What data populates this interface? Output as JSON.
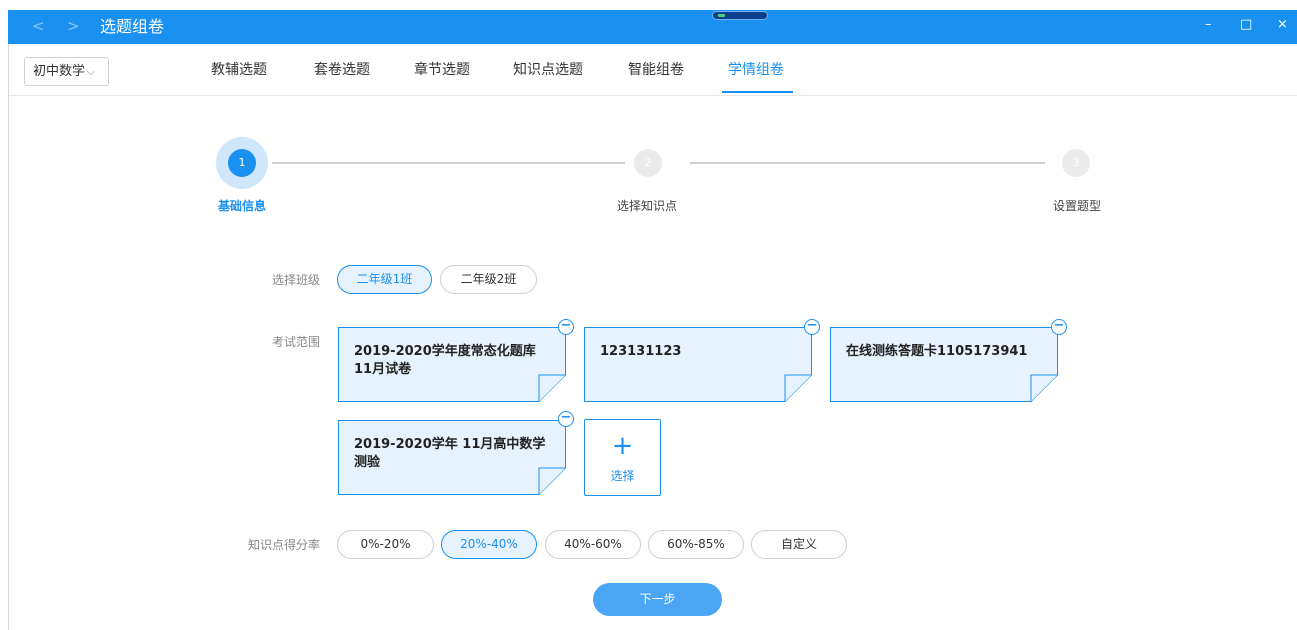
{
  "titlebar": {
    "back_icon": "<",
    "forward_icon": ">",
    "title": "选题组卷",
    "minimize": "–",
    "maximize": "□",
    "close": "×",
    "bg_color": "#1a90f0"
  },
  "toolbar": {
    "subject": "初中数学",
    "tabs": [
      {
        "label": "教辅选题"
      },
      {
        "label": "套卷选题"
      },
      {
        "label": "章节选题"
      },
      {
        "label": "知识点选题"
      },
      {
        "label": "智能组卷"
      },
      {
        "label": "学情组卷",
        "active": true
      }
    ]
  },
  "steps": [
    {
      "number": "1",
      "label": "基础信息",
      "active": true
    },
    {
      "number": "2",
      "label": "选择知识点",
      "active": false
    },
    {
      "number": "3",
      "label": "设置题型",
      "active": false
    }
  ],
  "form": {
    "class_label": "选择班级",
    "classes": [
      {
        "label": "二年级1班",
        "selected": true
      },
      {
        "label": "二年级2班",
        "selected": false
      }
    ],
    "scope_label": "考试范围",
    "exams": [
      {
        "line1": "2019-2020学年度常态化题库",
        "line2": "11月试卷"
      },
      {
        "line1": "123131123",
        "line2": ""
      },
      {
        "line1": "在线测练答题卡1105173941",
        "line2": ""
      },
      {
        "line1": "2019-2020学年 11月高中数学",
        "line2": "测验"
      }
    ],
    "add_icon": "+",
    "add_label": "选择",
    "remove_icon": "−",
    "rate_label": "知识点得分率",
    "rates": [
      {
        "label": "0%-20%",
        "selected": false
      },
      {
        "label": "20%-40%",
        "selected": true
      },
      {
        "label": "40%-60%",
        "selected": false
      },
      {
        "label": "60%-85%",
        "selected": false
      },
      {
        "label": "自定义",
        "selected": false
      }
    ]
  },
  "next_button": "下一步",
  "colors": {
    "accent": "#1a90f0",
    "card_fill": "#e6f3fe",
    "next_button": "#4aa6f5"
  }
}
